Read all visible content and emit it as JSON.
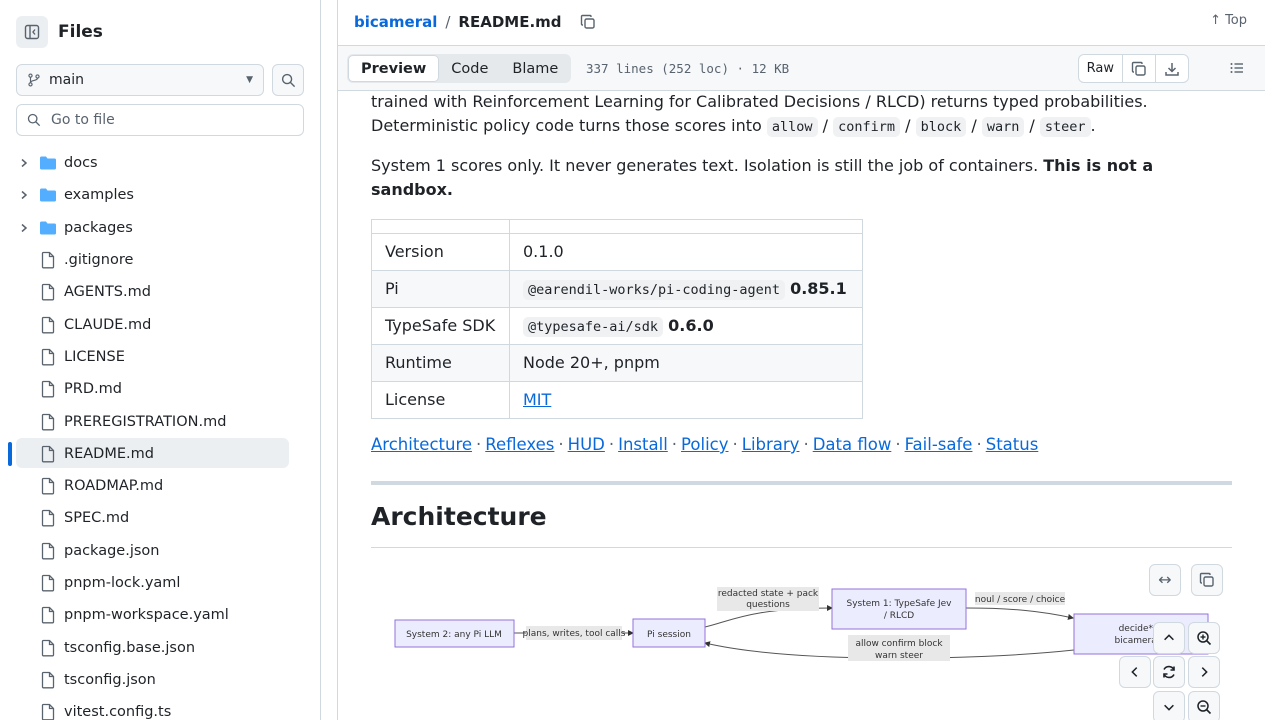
{
  "sidebar": {
    "title": "Files",
    "branch": "main",
    "go_to_file_placeholder": "Go to file",
    "items": [
      {
        "label": "docs",
        "type": "folder"
      },
      {
        "label": "examples",
        "type": "folder"
      },
      {
        "label": "packages",
        "type": "folder"
      },
      {
        "label": ".gitignore",
        "type": "file"
      },
      {
        "label": "AGENTS.md",
        "type": "file"
      },
      {
        "label": "CLAUDE.md",
        "type": "file"
      },
      {
        "label": "LICENSE",
        "type": "file"
      },
      {
        "label": "PRD.md",
        "type": "file"
      },
      {
        "label": "PREREGISTRATION.md",
        "type": "file"
      },
      {
        "label": "README.md",
        "type": "file",
        "active": true
      },
      {
        "label": "ROADMAP.md",
        "type": "file"
      },
      {
        "label": "SPEC.md",
        "type": "file"
      },
      {
        "label": "package.json",
        "type": "file"
      },
      {
        "label": "pnpm-lock.yaml",
        "type": "file"
      },
      {
        "label": "pnpm-workspace.yaml",
        "type": "file"
      },
      {
        "label": "tsconfig.base.json",
        "type": "file"
      },
      {
        "label": "tsconfig.json",
        "type": "file"
      },
      {
        "label": "vitest.config.ts",
        "type": "file"
      }
    ]
  },
  "header": {
    "repo": "bicameral",
    "separator": "/",
    "file": "README.md",
    "top_label": "Top"
  },
  "filebar": {
    "tabs": [
      "Preview",
      "Code",
      "Blame"
    ],
    "active_tab": "Preview",
    "info": "337 lines (252 loc) · 12 KB",
    "raw_label": "Raw"
  },
  "readme": {
    "p1_line1": "trained with Reinforcement Learning for Calibrated Decisions / RLCD) returns typed probabilities.",
    "p1_line2": "Deterministic policy code turns those scores into",
    "p1_codes": [
      "allow",
      "confirm",
      "block",
      "warn",
      "steer"
    ],
    "p1_sep": "/",
    "p1_end": ".",
    "p2_text": "System 1 scores only. It never generates text. Isolation is still the job of containers.",
    "p2_bold": "This is not a sandbox.",
    "table": [
      {
        "key": "Version",
        "value": "0.1.0"
      },
      {
        "key": "Pi",
        "code": "@earendil-works/pi-coding-agent",
        "bold": "0.85.1"
      },
      {
        "key": "TypeSafe SDK",
        "code": "@typesafe-ai/sdk",
        "bold": "0.6.0"
      },
      {
        "key": "Runtime",
        "value": "Node 20+, pnpm"
      },
      {
        "key": "License",
        "link": "MIT"
      }
    ],
    "nav_links": [
      "Architecture",
      "Reflexes",
      "HUD",
      "Install",
      "Policy",
      "Library",
      "Data flow",
      "Fail-safe",
      "Status"
    ],
    "nav_sep": "·",
    "heading": "Architecture"
  },
  "diagram": {
    "nodes": {
      "system2": "System 2: any Pi LLM",
      "pi_session": "Pi session",
      "system1_l1": "System 1: TypeSafe Jev",
      "system1_l2": "/ RLCD",
      "decide_l1": "decide* +",
      "decide_l2": "bicameral.y"
    },
    "edges": {
      "plans": "plans, writes, tool calls",
      "redacted_l1": "redacted state + pack",
      "redacted_l2": "questions",
      "scores": "noul / score / choice",
      "allow_l1": "allow confirm block",
      "allow_l2": "warn steer"
    }
  }
}
